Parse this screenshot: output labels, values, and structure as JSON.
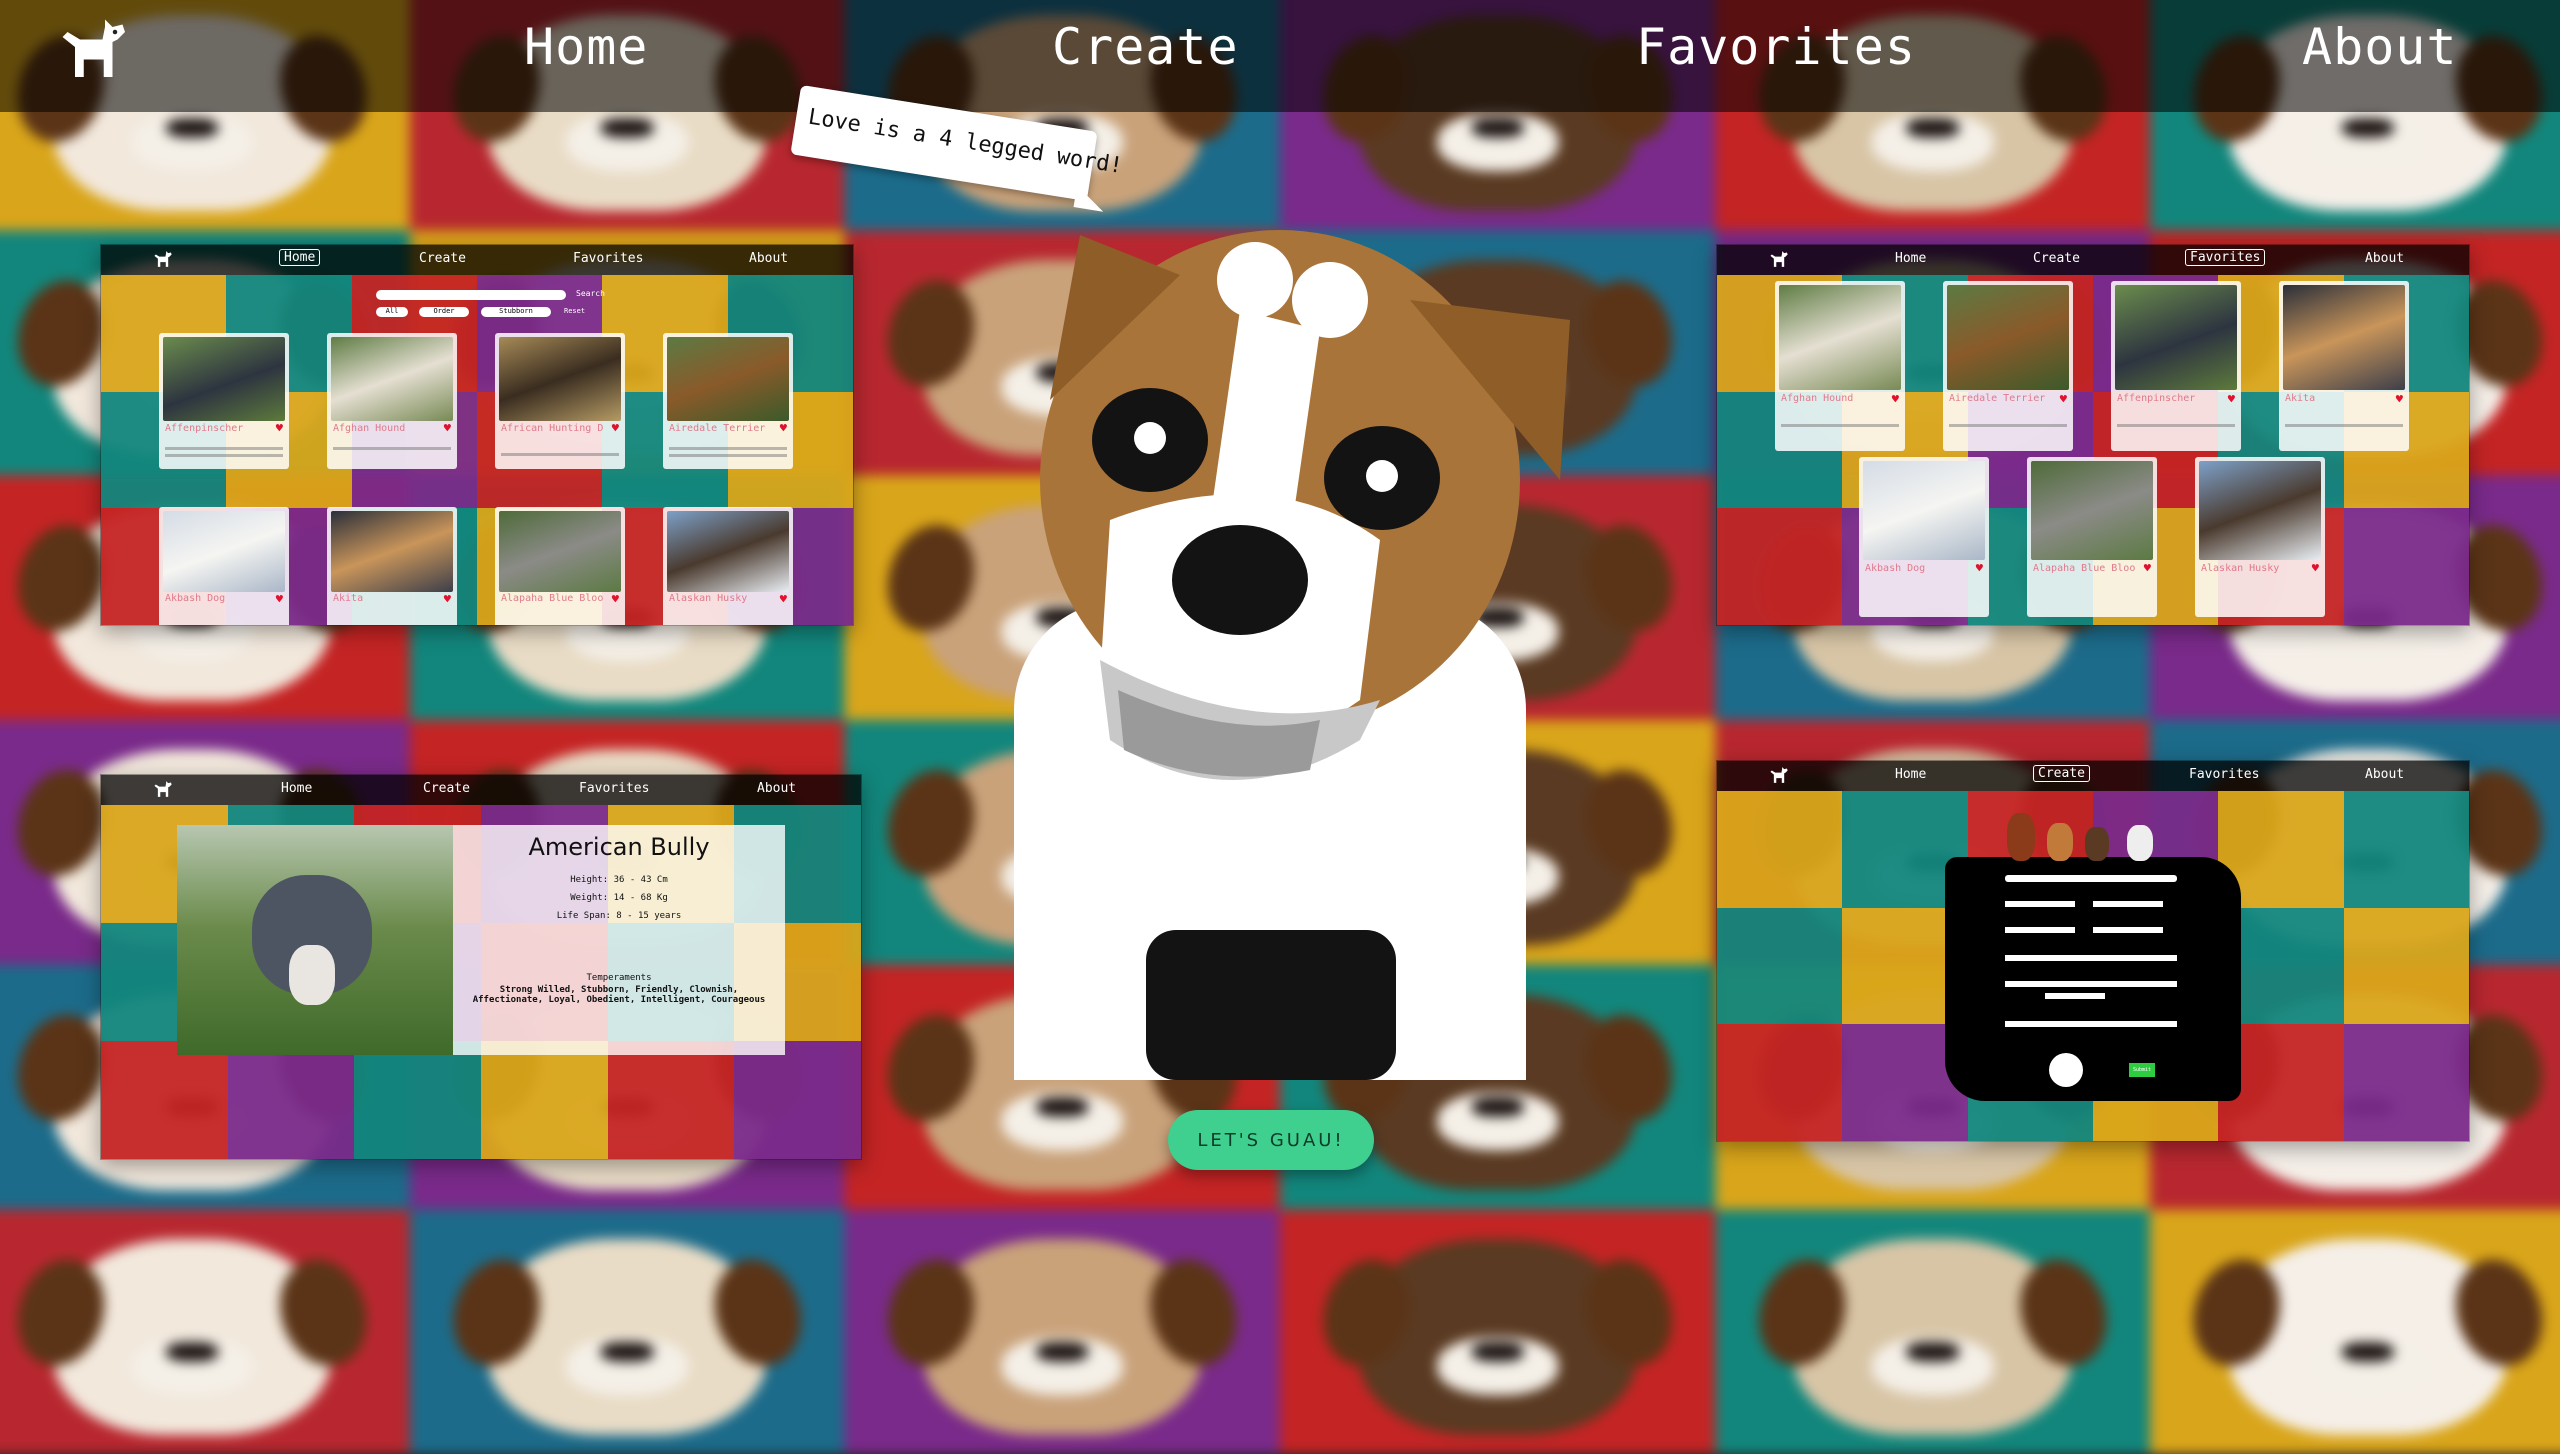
{
  "nav": {
    "logo_icon": "dog-icon",
    "items": [
      {
        "label": "Home"
      },
      {
        "label": "Create"
      },
      {
        "label": "Favorites"
      },
      {
        "label": "About"
      }
    ]
  },
  "hero": {
    "speech": "Love is a 4 legged word!",
    "cta_label": "LET'S GUAU!",
    "illustration_icon": "jack-russell-dog-icon"
  },
  "previews": {
    "home": {
      "nav": [
        "Home",
        "Create",
        "Favorites",
        "About"
      ],
      "selected": "Home",
      "filters": {
        "search_label": "Search",
        "all": "All",
        "order": "Order",
        "temper": "Stubborn",
        "reset": "Reset"
      },
      "cards": [
        {
          "name": "Affenpinscher"
        },
        {
          "name": "Afghan Hound"
        },
        {
          "name": "African Hunting Dog"
        },
        {
          "name": "Airedale Terrier"
        },
        {
          "name": "Akbash Dog"
        },
        {
          "name": "Akita"
        },
        {
          "name": "Alapaha Blue Blood"
        },
        {
          "name": "Alaskan Husky"
        }
      ]
    },
    "favorites": {
      "nav": [
        "Home",
        "Create",
        "Favorites",
        "About"
      ],
      "selected": "Favorites",
      "cards": [
        {
          "name": "Afghan Hound"
        },
        {
          "name": "Airedale Terrier"
        },
        {
          "name": "Affenpinscher"
        },
        {
          "name": "Akita"
        },
        {
          "name": "Akbash Dog"
        },
        {
          "name": "Alapaha Blue Blood Bulldog"
        },
        {
          "name": "Alaskan Husky"
        }
      ]
    },
    "detail": {
      "nav": [
        "Home",
        "Create",
        "Favorites",
        "About"
      ],
      "title": "American Bully",
      "height": "Height: 36 - 43 Cm",
      "weight": "Weight: 14 - 68 Kg",
      "life_span": "Life Span: 8 - 15 years",
      "temperaments_label": "Temperaments",
      "temperaments": "Strong Willed, Stubborn, Friendly, Clownish, Affectionate, Loyal, Obedient, Intelligent, Courageous"
    },
    "create": {
      "nav": [
        "Home",
        "Create",
        "Favorites",
        "About"
      ],
      "selected": "Create",
      "submit_label": "Submit"
    }
  },
  "colors": {
    "cta": "#3fcf8e",
    "dog_brown": "#a9743a",
    "heart": "#e0122d"
  }
}
